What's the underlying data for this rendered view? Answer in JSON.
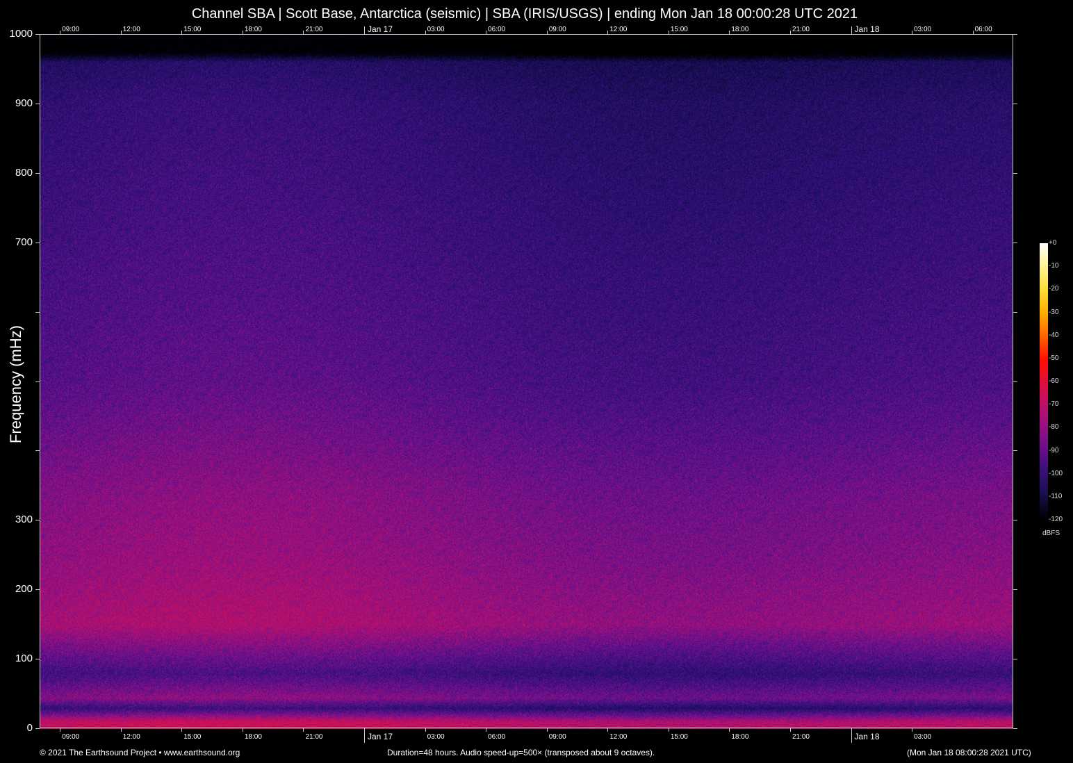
{
  "title": "Channel SBA | Scott Base, Antarctica (seismic) | SBA (IRIS/USGS) | ending Mon Jan 18 00:00:28 UTC 2021",
  "footer": {
    "copyright": "© 2021 The Earthsound Project • www.earthsound.org",
    "duration": "Duration=48 hours. Audio speed-up=500× (transposed about 9 octaves).",
    "generated": "(Mon Jan 18 08:00:28 2021 UTC)"
  },
  "chart_data": {
    "type": "heatmap",
    "title": "Channel SBA | Scott Base, Antarctica (seismic) | SBA (IRIS/USGS) | ending Mon Jan 18 00:00:28 UTC 2021",
    "ylabel": "Frequency (mHz)",
    "xlabel": "",
    "ylim": [
      0,
      1000
    ],
    "xlim_hours": [
      0,
      48
    ],
    "y_ticks": [
      0,
      100,
      200,
      300,
      400,
      500,
      600,
      700,
      800,
      900,
      1000
    ],
    "y_tick_labels": [
      "0",
      "100",
      "200",
      "300",
      "",
      "",
      "",
      "700",
      "800",
      "900",
      "1000"
    ],
    "x_ticks_top": [
      {
        "h": 1,
        "label": "09:00"
      },
      {
        "h": 4,
        "label": "12:00"
      },
      {
        "h": 7,
        "label": "15:00"
      },
      {
        "h": 10,
        "label": "18:00"
      },
      {
        "h": 13,
        "label": "21:00"
      },
      {
        "h": 16,
        "label": "Jan 17",
        "day": true
      },
      {
        "h": 19,
        "label": "03:00"
      },
      {
        "h": 22,
        "label": "06:00"
      },
      {
        "h": 25,
        "label": "09:00"
      },
      {
        "h": 28,
        "label": "12:00"
      },
      {
        "h": 31,
        "label": "15:00"
      },
      {
        "h": 34,
        "label": "18:00"
      },
      {
        "h": 37,
        "label": "21:00"
      },
      {
        "h": 40,
        "label": "Jan 18",
        "day": true
      },
      {
        "h": 43,
        "label": "03:00"
      },
      {
        "h": 46,
        "label": "06:00"
      }
    ],
    "x_ticks_bottom": [
      {
        "h": 1,
        "label": "09:00"
      },
      {
        "h": 4,
        "label": "12:00"
      },
      {
        "h": 7,
        "label": "15:00"
      },
      {
        "h": 10,
        "label": "18:00"
      },
      {
        "h": 13,
        "label": "21:00"
      },
      {
        "h": 16,
        "label": "Jan 17",
        "day": true
      },
      {
        "h": 19,
        "label": "03:00"
      },
      {
        "h": 22,
        "label": "06:00"
      },
      {
        "h": 25,
        "label": "09:00"
      },
      {
        "h": 28,
        "label": "12:00"
      },
      {
        "h": 31,
        "label": "15:00"
      },
      {
        "h": 34,
        "label": "18:00"
      },
      {
        "h": 37,
        "label": "21:00"
      },
      {
        "h": 40,
        "label": "Jan 18",
        "day": true
      },
      {
        "h": 43,
        "label": "03:00"
      }
    ],
    "colorbar": {
      "unit": "dBFS",
      "range": [
        -120,
        0
      ],
      "ticks": [
        "+0",
        "-10",
        "-20",
        "-30",
        "-40",
        "-50",
        "-60",
        "-70",
        "-80",
        "-90",
        "-100",
        "-110",
        "-120"
      ]
    },
    "approx_level_profile_db": [
      {
        "mHz": 10,
        "db": -68
      },
      {
        "mHz": 30,
        "db": -95
      },
      {
        "mHz": 45,
        "db": -80
      },
      {
        "mHz": 80,
        "db": -92
      },
      {
        "mHz": 150,
        "db": -74
      },
      {
        "mHz": 250,
        "db": -78
      },
      {
        "mHz": 330,
        "db": -80
      },
      {
        "mHz": 500,
        "db": -88
      },
      {
        "mHz": 700,
        "db": -92
      },
      {
        "mHz": 900,
        "db": -96
      },
      {
        "mHz": 960,
        "db": -100
      },
      {
        "mHz": 975,
        "db": -125
      }
    ]
  }
}
